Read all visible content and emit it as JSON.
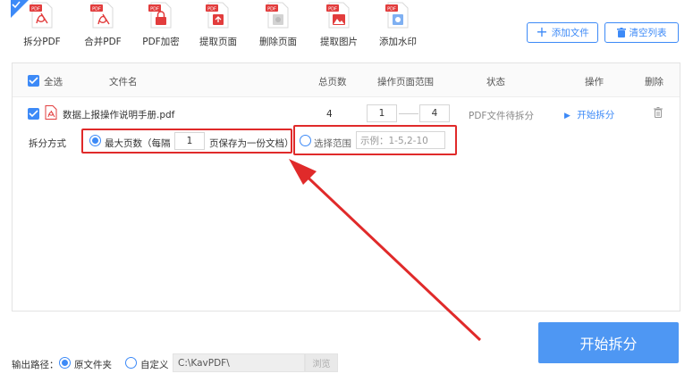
{
  "toolbar": {
    "tools": [
      {
        "label": "拆分PDF",
        "icon": "split-pdf-icon",
        "active": true
      },
      {
        "label": "合并PDF",
        "icon": "merge-pdf-icon",
        "active": false
      },
      {
        "label": "PDF加密",
        "icon": "encrypt-pdf-icon",
        "active": false
      },
      {
        "label": "提取页面",
        "icon": "extract-pages-icon",
        "active": false
      },
      {
        "label": "删除页面",
        "icon": "delete-pages-icon",
        "active": false
      },
      {
        "label": "提取图片",
        "icon": "extract-images-icon",
        "active": false
      },
      {
        "label": "添加水印",
        "icon": "add-watermark-icon",
        "active": false
      }
    ],
    "add_file_label": "添加文件",
    "clear_list_label": "清空列表"
  },
  "table": {
    "select_all_label": "全选",
    "headers": {
      "filename": "文件名",
      "total_pages": "总页数",
      "page_range": "操作页面范围",
      "status": "状态",
      "action": "操作",
      "delete": "删除"
    },
    "row": {
      "filename": "数据上报操作说明手册.pdf",
      "total_pages": "4",
      "range_from": "1",
      "range_to": "4",
      "status": "PDF文件待拆分",
      "action_label": "开始拆分"
    }
  },
  "split_mode": {
    "label": "拆分方式",
    "option_max_pages_prefix": "最大页数（每隔",
    "max_pages_value": "1",
    "option_max_pages_suffix": "页保存为一份文档）",
    "option_range_label": "选择范围",
    "range_placeholder": "示例：1-5,2-10",
    "selected": "max_pages"
  },
  "output": {
    "label": "输出路径：",
    "option_original": "原文件夹",
    "option_custom": "自定义",
    "path_value": "C:\\KavPDF\\",
    "browse_label": "浏览",
    "selected": "original"
  },
  "start_button_label": "开始拆分",
  "colors": {
    "accent": "#3d8af7",
    "start_button": "#4e97f3",
    "highlight_red": "#e02a2a"
  }
}
